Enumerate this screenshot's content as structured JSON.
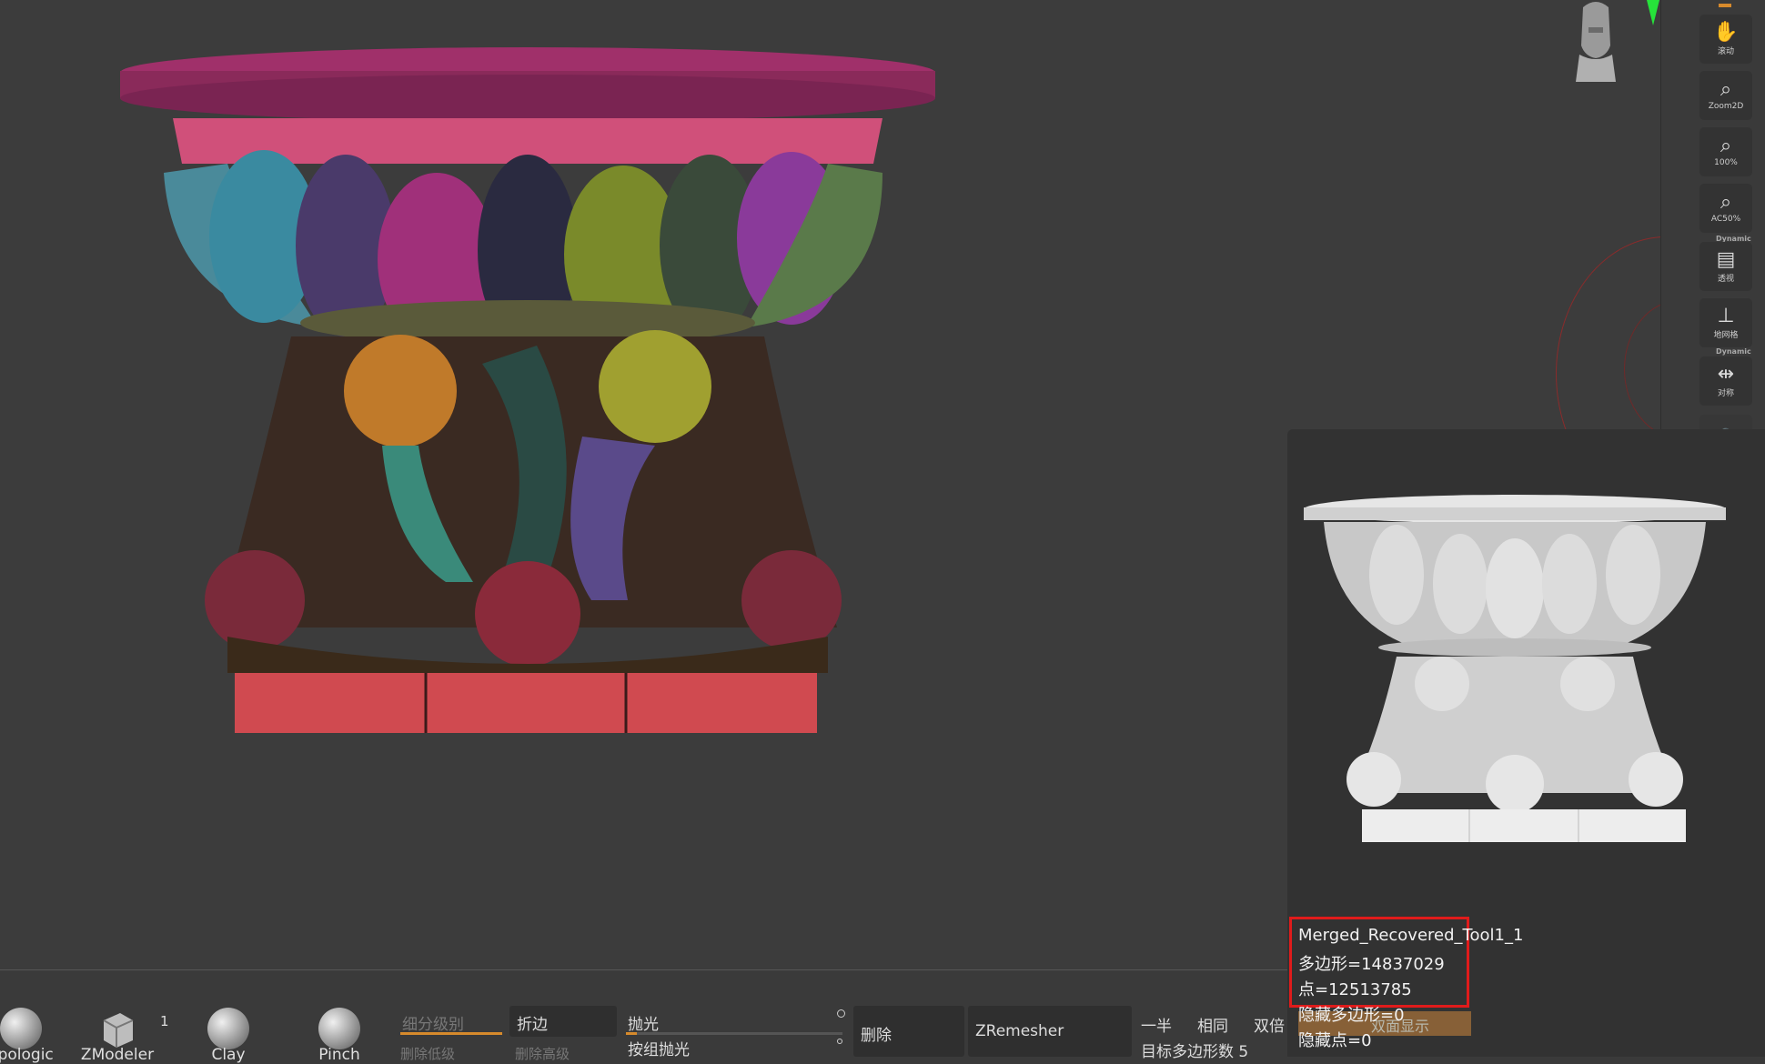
{
  "viewport": {
    "orientation_head": "head-orientation-icon",
    "marker_color": "#26e23a"
  },
  "right_shelf": {
    "buttons": [
      {
        "label": "滚动",
        "icon": "scroll-hand-icon"
      },
      {
        "label": "Zoom2D",
        "icon": "zoom2d-icon"
      },
      {
        "label": "100%",
        "icon": "zoom-100-icon"
      },
      {
        "label": "AC50%",
        "icon": "zoom-ac50-icon"
      },
      {
        "label": "透视",
        "icon": "perspective-icon"
      },
      {
        "label": "地网格",
        "icon": "floor-grid-icon"
      },
      {
        "label": "对称",
        "icon": "symmetry-icon"
      }
    ],
    "tags": [
      "Dynamic",
      "Dynamic"
    ],
    "accent": "#b57a3a"
  },
  "preview": {
    "tool_name": "Merged_Recovered_Tool1_1",
    "polygons": "多边形=14837029",
    "points": "点=12513785",
    "hidden_polys": "隐藏多边形=0",
    "hidden_points": "隐藏点=0",
    "overlay_text": "双面显示",
    "highlight_color": "#e01b1b"
  },
  "bottom": {
    "brushes": [
      {
        "name": "opologic",
        "icon": "topologic-brush-icon"
      },
      {
        "name": "ZModeler",
        "icon": "zmodeler-brush-icon",
        "count": "1"
      },
      {
        "name": "Clay",
        "icon": "clay-brush-icon"
      },
      {
        "name": "Pinch",
        "icon": "pinch-brush-icon"
      }
    ],
    "subdiv_label": "细分级别",
    "del_lower": "删除低级",
    "crease": "折边",
    "del_higher": "删除高级",
    "polish": "抛光",
    "group_polish": "按组抛光",
    "delete": "删除",
    "zremesher": "ZRemesher",
    "half": "一半",
    "same": "相同",
    "double": "双倍",
    "target_poly": "目标多边形数 5"
  }
}
